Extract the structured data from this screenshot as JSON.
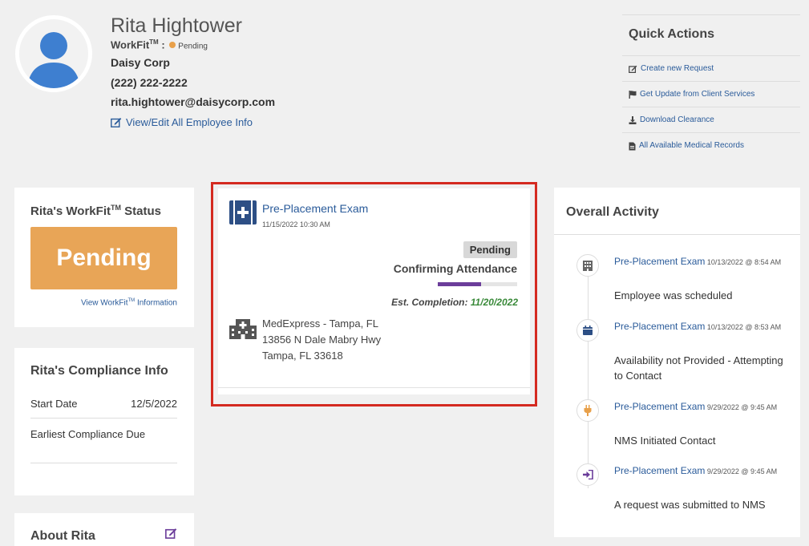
{
  "profile": {
    "name": "Rita Hightower",
    "workfit_label": "WorkFit",
    "workfit_tm": "TM",
    "workfit_sep": " :",
    "workfit_status": "Pending",
    "company": "Daisy Corp",
    "phone": "(222) 222-2222",
    "email": "rita.hightower@daisycorp.com",
    "view_edit_link": "View/Edit All Employee Info",
    "status_color": "#e8a04a"
  },
  "quick_actions": {
    "title": "Quick Actions",
    "items": [
      {
        "label": "Create new Request",
        "icon": "edit-icon"
      },
      {
        "label": "Get Update from Client Services",
        "icon": "flag-icon"
      },
      {
        "label": "Download Clearance",
        "icon": "download-icon"
      },
      {
        "label": "All Available Medical Records",
        "icon": "document-icon"
      }
    ]
  },
  "status_card": {
    "title_prefix": "Rita's ",
    "title_brand": "WorkFit",
    "title_tm": "TM",
    "title_suffix": " Status",
    "status": "Pending",
    "link_prefix": "View WorkFit",
    "link_tm": "TM",
    "link_suffix": " Information",
    "status_color": "#e8a557"
  },
  "compliance": {
    "title": "Rita's Compliance Info",
    "start_label": "Start Date",
    "start_value": "12/5/2022",
    "earliest_label": "Earliest Compliance Due"
  },
  "about": {
    "title": "About Rita"
  },
  "exam": {
    "title": "Pre-Placement Exam",
    "datetime": "11/15/2022 10:30 AM",
    "badge": "Pending",
    "step": "Confirming Attendance",
    "progress": 0.55,
    "est_label": "Est. Completion: ",
    "est_date": "11/20/2022",
    "location": {
      "name": "MedExpress - Tampa, FL",
      "street": "13856 N Dale Mabry Hwy",
      "city": "Tampa, FL 33618"
    }
  },
  "activity": {
    "title": "Overall Activity",
    "items": [
      {
        "title": "Pre-Placement Exam",
        "meta": " 10/13/2022 @ 8:54 AM",
        "desc": "Employee was scheduled",
        "icon": "building-icon"
      },
      {
        "title": "Pre-Placement Exam",
        "meta": " 10/13/2022 @ 8:53 AM",
        "desc": "Availability not Provided - Attempting to Contact",
        "icon": "calendar-icon"
      },
      {
        "title": "Pre-Placement Exam",
        "meta": " 9/29/2022 @ 9:45 AM",
        "desc": "NMS Initiated Contact",
        "icon": "plug-icon"
      },
      {
        "title": "Pre-Placement Exam",
        "meta": " 9/29/2022 @ 9:45 AM",
        "desc": "A request was submitted to NMS",
        "icon": "sign-in-icon"
      }
    ]
  }
}
